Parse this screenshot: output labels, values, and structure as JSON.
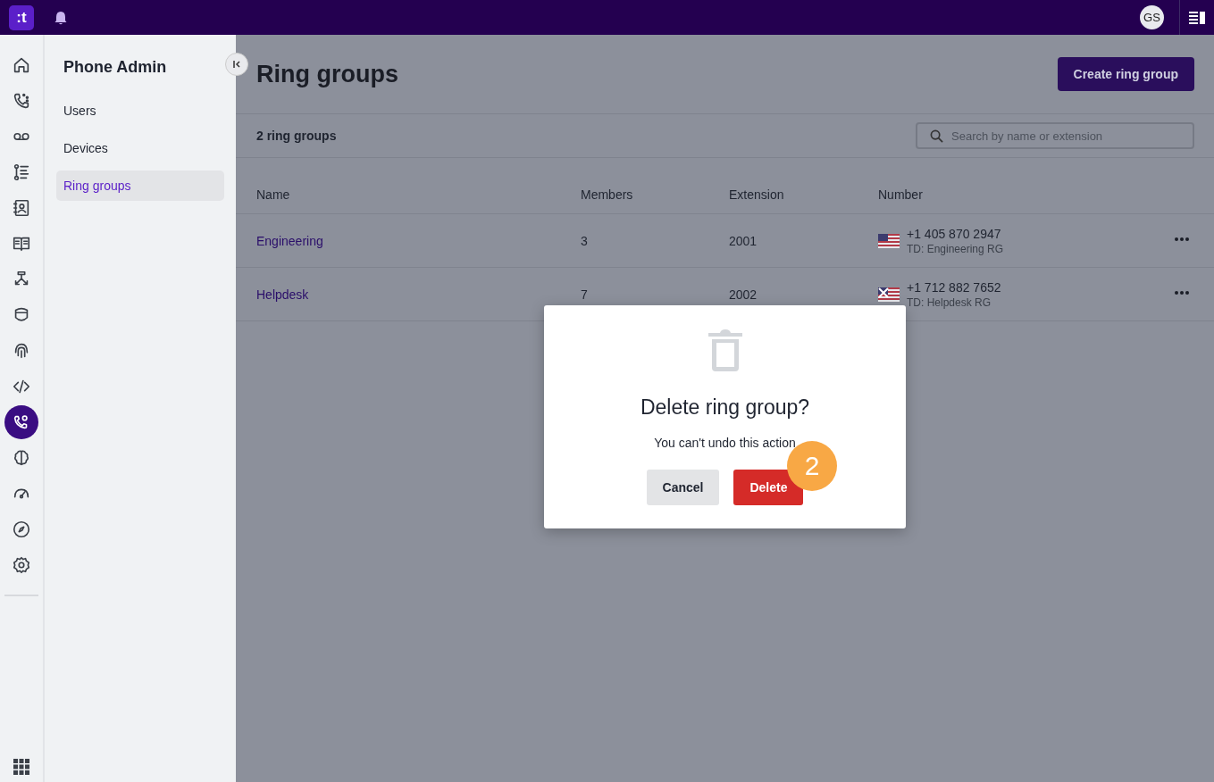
{
  "top_bar": {
    "logo": ":t",
    "avatar": "GS"
  },
  "rail": [
    {
      "selected": false
    },
    {
      "selected": false
    },
    {
      "selected": false
    },
    {
      "selected": false
    },
    {
      "selected": false
    },
    {
      "selected": false
    },
    {
      "selected": false
    },
    {
      "selected": false
    },
    {
      "selected": false
    },
    {
      "selected": false
    },
    {
      "selected": true
    },
    {
      "selected": false
    },
    {
      "selected": false
    },
    {
      "selected": false
    },
    {
      "selected": false
    }
  ],
  "sidebar": {
    "title": "Phone Admin",
    "items": [
      {
        "label": "Users",
        "selected": false
      },
      {
        "label": "Devices",
        "selected": false
      },
      {
        "label": "Ring groups",
        "selected": true
      }
    ]
  },
  "page": {
    "title": "Ring groups",
    "create_button": "Create ring group",
    "count": "2 ring groups",
    "search": {
      "placeholder": "Search by name or extension"
    }
  },
  "table": {
    "columns": [
      "Name",
      "Members",
      "Extension",
      "Number"
    ],
    "rows": [
      {
        "name": "Engineering",
        "members": "3",
        "extension": "2001",
        "number": "+1 405 870 2947",
        "caller_id": "TD: Engineering RG",
        "flag_crossed": false
      },
      {
        "name": "Helpdesk",
        "members": "7",
        "extension": "2002",
        "number": "+1 712 882 7652",
        "caller_id": "TD: Helpdesk RG",
        "flag_crossed": true
      }
    ]
  },
  "dialog": {
    "title": "Delete ring group?",
    "message": "You can't undo this action",
    "buttons": [
      {
        "label": "Cancel",
        "kind": "secondary"
      },
      {
        "label": "Delete",
        "kind": "danger"
      }
    ],
    "step_badge": "2"
  }
}
